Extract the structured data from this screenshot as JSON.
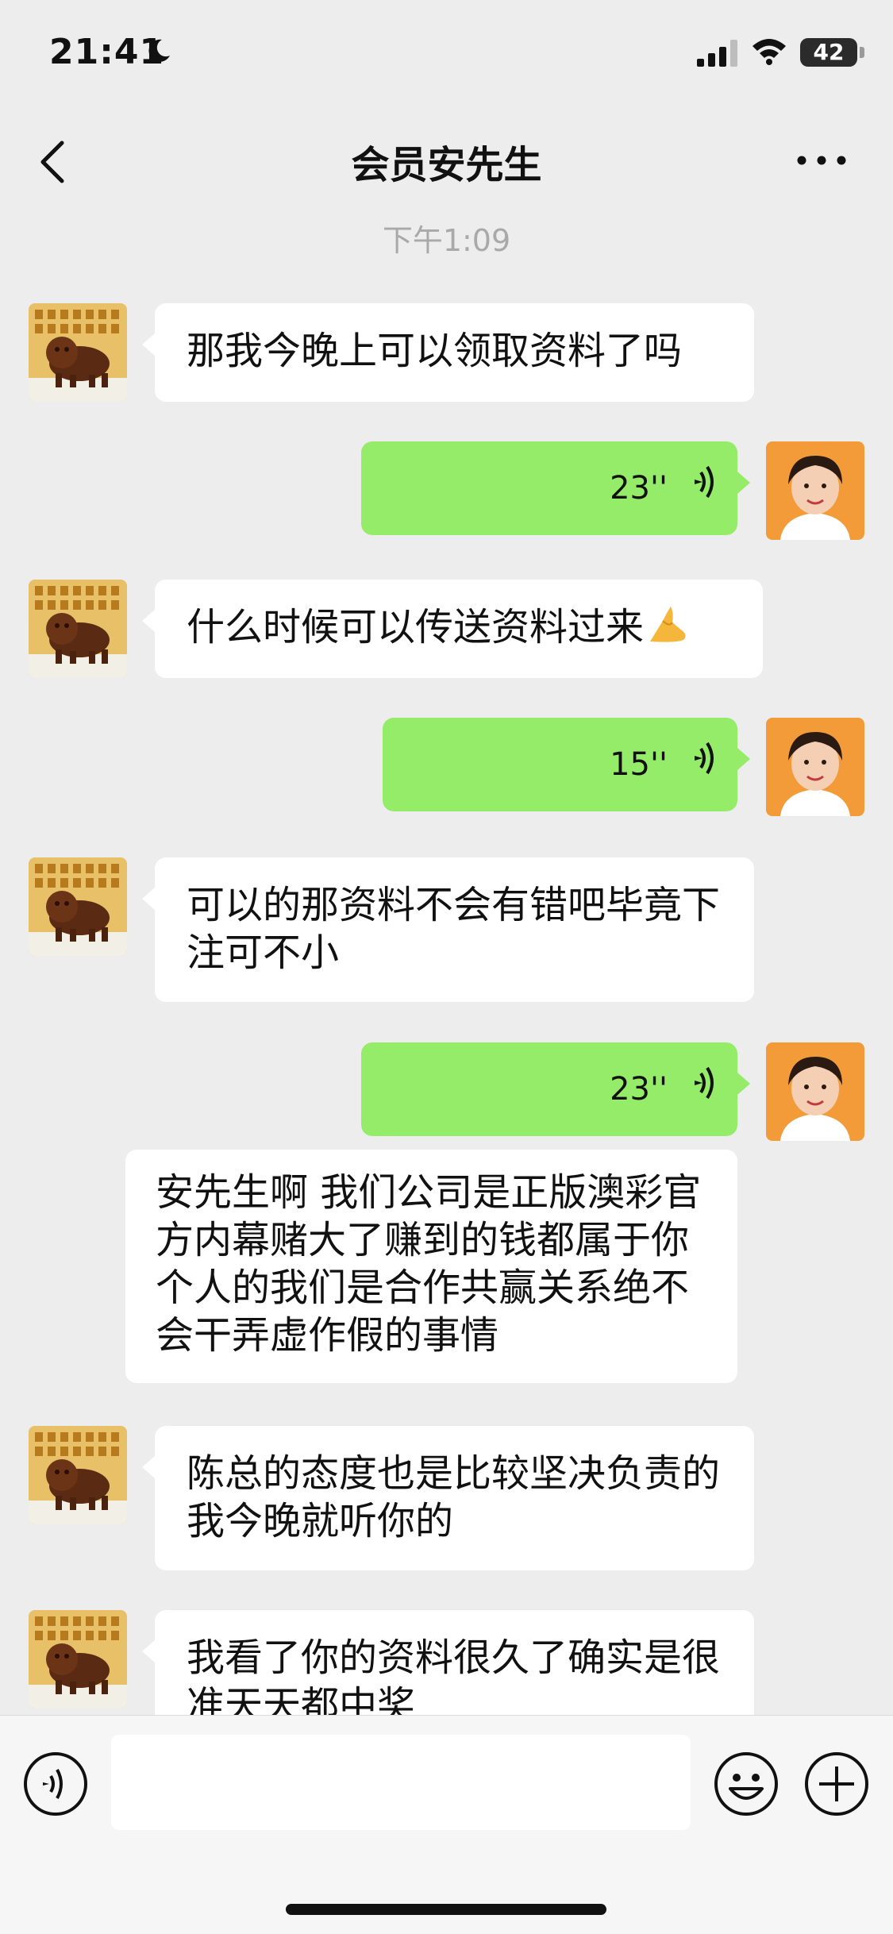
{
  "status_bar": {
    "time": "21:41",
    "battery": "42"
  },
  "header": {
    "title": "会员安先生"
  },
  "chat": {
    "time_divider": "下午1:09",
    "messages": [
      {
        "side": "in",
        "text": "那我今晚上可以领取资料了吗"
      },
      {
        "side": "out",
        "type": "voice",
        "duration": "23''"
      },
      {
        "side": "in",
        "text": "什么时候可以传送资料过来",
        "emoji": "folded-hands"
      },
      {
        "side": "out",
        "type": "voice",
        "duration": "15''"
      },
      {
        "side": "in",
        "text": "可以的那资料不会有错吧毕竟下注可不小"
      },
      {
        "side": "out",
        "type": "voice",
        "duration": "23''"
      },
      {
        "side": "in",
        "text": "安先生啊 我们公司是正版澳彩官方内幕赌大了赚到的钱都属于你个人的我们是合作共赢关系绝不会干弄虚作假的事情"
      },
      {
        "side": "in",
        "text": "陈总的态度也是比较坚决负责的我今晚就听你的"
      },
      {
        "side": "in",
        "text": "我看了你的资料很久了确实是很准天天都中奖"
      }
    ]
  },
  "input_bar": {
    "placeholder": ""
  },
  "colors": {
    "background": "#ededed",
    "outgoing_bubble": "#95ec69",
    "incoming_bubble": "#ffffff",
    "timestamp": "#a9a9a9"
  },
  "icons": {
    "status": [
      "moon-icon",
      "signal-icon",
      "wifi-icon",
      "battery-icon"
    ],
    "header": [
      "back-icon",
      "more-icon"
    ],
    "voice": "voice-wave-icon",
    "input_bar": [
      "voice-input-icon",
      "emoji-icon",
      "add-icon"
    ]
  }
}
